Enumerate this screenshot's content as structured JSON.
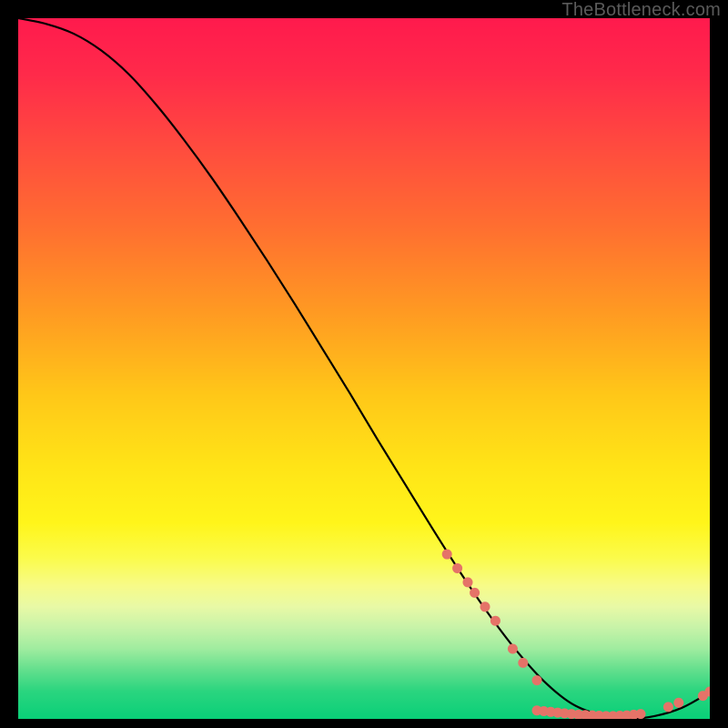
{
  "watermark": "TheBottleneck.com",
  "chart_data": {
    "type": "line",
    "title": "",
    "xlabel": "",
    "ylabel": "",
    "xlim": [
      0,
      100
    ],
    "ylim": [
      0,
      100
    ],
    "series": [
      {
        "name": "curve",
        "x": [
          0,
          4,
          8,
          12,
          16,
          20,
          24,
          28,
          32,
          36,
          40,
          44,
          48,
          52,
          56,
          60,
          64,
          68,
          72,
          76,
          80,
          84,
          88,
          92,
          96,
          100
        ],
        "y": [
          100,
          99.2,
          97.8,
          95.4,
          92.0,
          87.6,
          82.6,
          77.2,
          71.4,
          65.4,
          59.2,
          52.8,
          46.4,
          39.8,
          33.4,
          27.0,
          20.8,
          15.0,
          9.8,
          5.4,
          2.2,
          0.6,
          0.0,
          0.4,
          1.6,
          3.8
        ]
      }
    ],
    "scatter_clusters": [
      {
        "name": "upper-band",
        "points": [
          {
            "x": 62,
            "y": 23.5
          },
          {
            "x": 63.5,
            "y": 21.5
          },
          {
            "x": 65,
            "y": 19.5
          },
          {
            "x": 66,
            "y": 18
          },
          {
            "x": 67.5,
            "y": 16
          },
          {
            "x": 69,
            "y": 14
          }
        ]
      },
      {
        "name": "transition",
        "points": [
          {
            "x": 71.5,
            "y": 10
          },
          {
            "x": 73,
            "y": 8
          },
          {
            "x": 75,
            "y": 5.5
          }
        ]
      },
      {
        "name": "bottom-band",
        "points": [
          {
            "x": 75,
            "y": 1.2
          },
          {
            "x": 76,
            "y": 1.1
          },
          {
            "x": 77,
            "y": 1.0
          },
          {
            "x": 78,
            "y": 0.9
          },
          {
            "x": 79,
            "y": 0.8
          },
          {
            "x": 80,
            "y": 0.7
          },
          {
            "x": 81,
            "y": 0.6
          },
          {
            "x": 82,
            "y": 0.55
          },
          {
            "x": 83,
            "y": 0.5
          },
          {
            "x": 84,
            "y": 0.45
          },
          {
            "x": 85,
            "y": 0.4
          },
          {
            "x": 86,
            "y": 0.4
          },
          {
            "x": 87,
            "y": 0.45
          },
          {
            "x": 88,
            "y": 0.5
          },
          {
            "x": 89,
            "y": 0.6
          },
          {
            "x": 90,
            "y": 0.7
          }
        ]
      },
      {
        "name": "rise-band",
        "points": [
          {
            "x": 94,
            "y": 1.7
          },
          {
            "x": 95.5,
            "y": 2.3
          }
        ]
      },
      {
        "name": "tip",
        "points": [
          {
            "x": 99,
            "y": 3.3
          },
          {
            "x": 100,
            "y": 3.9
          }
        ]
      }
    ],
    "dot_color": "#e57368",
    "curve_color": "#000000"
  }
}
